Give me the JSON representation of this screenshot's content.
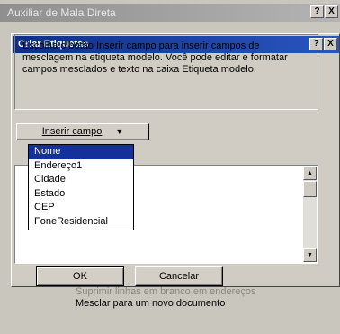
{
  "outer_window": {
    "title": "Auxiliar de Mala Direta",
    "help_label": "?",
    "close_label": "X",
    "bottom_lines": [
      "Suprimir linhas em branco em endereços",
      "Mesclar para um novo documento"
    ]
  },
  "dialog": {
    "title": "Criar Etiquetas",
    "help_label": "?",
    "close_label": "X",
    "description": "Escolha o botão Inserir campo para inserir campos de mesclagem na etiqueta modelo. Você pode editar e formatar campos mesclados e texto na caixa Etiqueta modelo.",
    "insert_field_label": "Inserir campo",
    "field_options": [
      "Nome",
      "Endereço1",
      "Cidade",
      "Estado",
      "CEP",
      "FoneResidencial"
    ],
    "selected_field": "Nome",
    "ok_label": "OK",
    "cancel_label": "Cancelar"
  }
}
